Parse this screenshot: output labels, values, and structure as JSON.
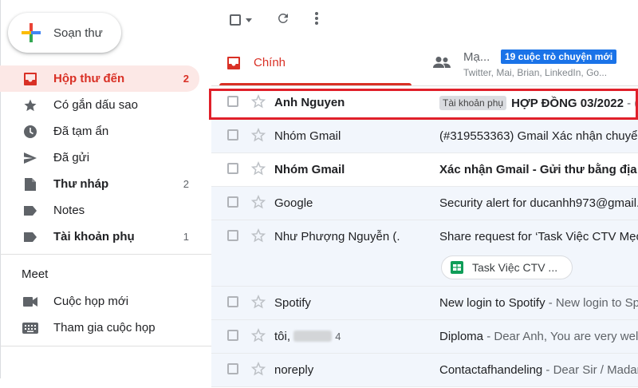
{
  "compose": {
    "label": "Soạn thư"
  },
  "sidebar": {
    "items": [
      {
        "label": "Hộp thư đến",
        "count": "2",
        "icon": "inbox-icon"
      },
      {
        "label": "Có gắn dấu sao",
        "count": "",
        "icon": "star-icon"
      },
      {
        "label": "Đã tạm ẩn",
        "count": "",
        "icon": "clock-icon"
      },
      {
        "label": "Đã gửi",
        "count": "",
        "icon": "send-icon"
      },
      {
        "label": "Thư nháp",
        "count": "2",
        "icon": "draft-icon"
      },
      {
        "label": "Notes",
        "count": "",
        "icon": "label-icon"
      },
      {
        "label": "Tài khoản phụ",
        "count": "1",
        "icon": "label-icon"
      }
    ]
  },
  "meet": {
    "title": "Meet",
    "items": [
      {
        "label": "Cuộc họp mới",
        "icon": "video-icon"
      },
      {
        "label": "Tham gia cuộc họp",
        "icon": "keyboard-icon"
      }
    ]
  },
  "tabs": {
    "primary": {
      "label": "Chính"
    },
    "social": {
      "label": "Mạ...",
      "badge": "19 cuộc trò chuyện mới",
      "subtitle": "Twitter, Mai, Brian, LinkedIn, Go..."
    }
  },
  "emails": [
    {
      "sender": "Anh Nguyen",
      "tag": "Tài khoản phụ",
      "subject": "HỢP ĐỒNG 03/2022",
      "snippet": " - (",
      "unread": true
    },
    {
      "sender": "Nhóm Gmail",
      "subject": "(#319553363) Gmail Xác nhận chuyển",
      "snippet": "",
      "unread": false
    },
    {
      "sender": "Nhóm Gmail",
      "subject": "Xác nhận Gmail - Gửi thư bằng địa ch",
      "snippet": "",
      "unread": true
    },
    {
      "sender": "Google",
      "subject": "Security alert for ducanhh973@gmail.",
      "snippet": "",
      "unread": false
    },
    {
      "sender": "Như Phượng Nguyễn (.",
      "subject": "Share request for ‘Task Việc CTV Mẹo",
      "snippet": "",
      "unread": false,
      "attachment": "Task Việc CTV ..."
    },
    {
      "sender": "Spotify",
      "subject": "New login to Spotify",
      "snippet": " - New login to Sp",
      "unread": false
    },
    {
      "sender": "tôi,",
      "count": "4",
      "subject": "Diploma",
      "snippet": " - Dear Anh, You are very welc",
      "unread": false
    },
    {
      "sender": "noreply",
      "subject": "Contactafhandeling",
      "snippet": " - Dear Sir / Madan",
      "unread": false
    }
  ],
  "colors": {
    "accent": "#d93025",
    "badge": "#1a73e8",
    "highlight": "#e0202a"
  }
}
